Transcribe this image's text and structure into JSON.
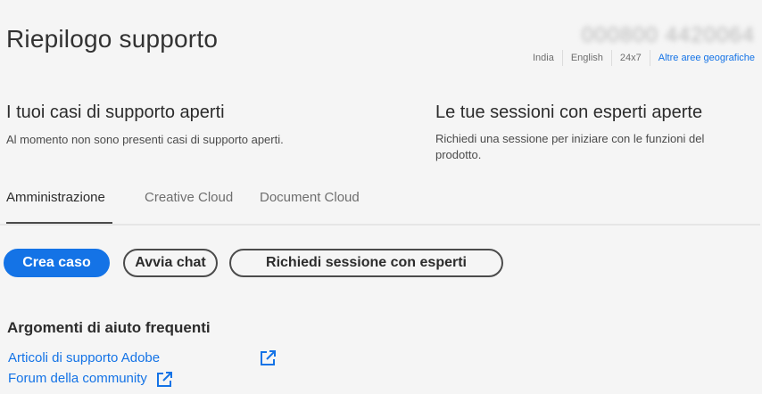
{
  "header": {
    "title": "Riepilogo supporto",
    "phone": "000800 4420064",
    "meta": [
      "India",
      "English",
      "24x7"
    ],
    "geo_link": "Altre aree geografiche"
  },
  "cases": {
    "title": "I tuoi casi di supporto aperti",
    "text": "Al momento non sono presenti casi di supporto aperti."
  },
  "sessions": {
    "title": "Le tue sessioni con esperti aperte",
    "text_line1": "Richiedi una sessione per iniziare con le funzioni del",
    "text_line2": "prodotto."
  },
  "tabs": [
    {
      "label": "Amministrazione",
      "active": true
    },
    {
      "label": "Creative Cloud",
      "active": false
    },
    {
      "label": "Document Cloud",
      "active": false
    }
  ],
  "actions": {
    "create_case": "Crea caso",
    "start_chat": "Avvia chat",
    "request_session": "Richiedi sessione con esperti"
  },
  "faq": {
    "title": "Argomenti di aiuto frequenti",
    "links": [
      "Articoli di supporto Adobe",
      "Forum della community"
    ]
  },
  "colors": {
    "accent": "#1473e6",
    "background": "#f5f5f5",
    "text": "#2c2c2c"
  },
  "icons": {
    "external_link": "external-link-icon"
  }
}
